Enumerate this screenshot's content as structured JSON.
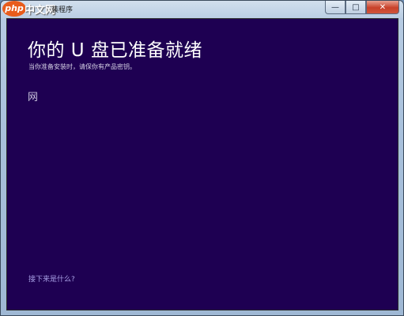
{
  "window": {
    "title": "装程序"
  },
  "watermark": {
    "logo": "php",
    "text": "中文网"
  },
  "controls": {
    "minimize": "—",
    "maximize": "□",
    "close": "✕"
  },
  "main": {
    "heading": "你的 U 盘已准备就绪",
    "subtext": "当你准备安装时，请保你有产品密钥。",
    "glyph": "网",
    "link": "接下来是什么?"
  },
  "colors": {
    "content_bg": "#1e0052",
    "heading": "#ffffff",
    "link": "#a9a0e6"
  }
}
